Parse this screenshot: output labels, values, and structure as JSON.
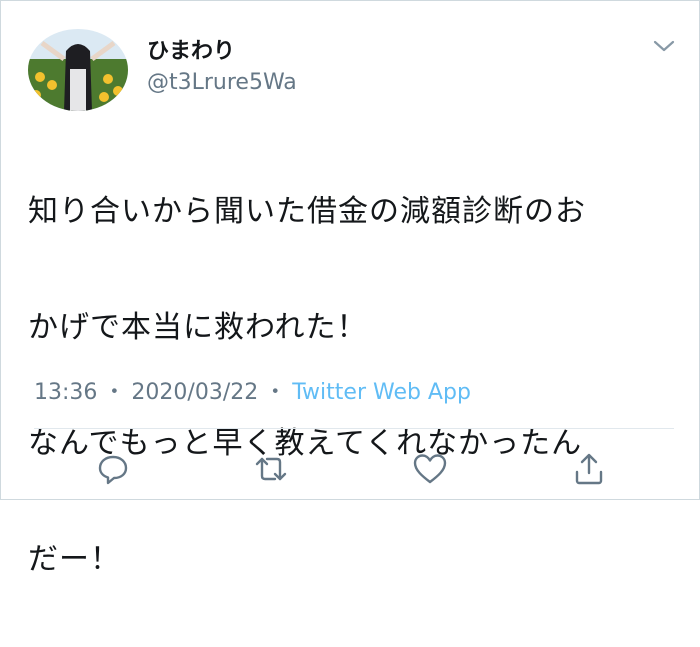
{
  "author": {
    "display_name": "ひまわり",
    "handle": "@t3Lrure5Wa",
    "avatar_icon": "sunflower-field-photo"
  },
  "tweet": {
    "lines": [
      "知り合いから聞いた借金の減額診断のお",
      "かげで本当に救われた！",
      "なんでもっと早く教えてくれなかったん",
      "だー！"
    ]
  },
  "meta": {
    "time": "13:36",
    "separator": "・",
    "date": "2020/03/22",
    "source": "Twitter Web App"
  },
  "actions": {
    "reply_icon": "reply-icon",
    "retweet_icon": "retweet-icon",
    "like_icon": "heart-icon",
    "share_icon": "share-icon"
  },
  "colors": {
    "text": "#14171a",
    "secondary": "#657786",
    "link": "#1da1f2",
    "border": "#e1e8ed"
  }
}
